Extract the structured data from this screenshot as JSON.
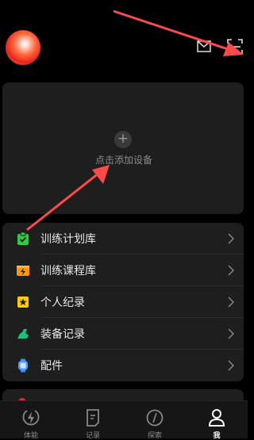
{
  "header": {
    "avatar": "user-avatar",
    "icons": [
      "mail-icon",
      "scan-icon"
    ]
  },
  "device": {
    "add_symbol": "+",
    "add_label": "点击添加设备"
  },
  "menu": {
    "items": [
      {
        "label": "训练计划库",
        "icon": "clipboard-icon",
        "color": "#2ecc40"
      },
      {
        "label": "训练课程库",
        "icon": "lightning-box-icon",
        "color": "#ff9500"
      },
      {
        "label": "个人纪录",
        "icon": "star-badge-icon",
        "color": "#ffcc00"
      },
      {
        "label": "装备记录",
        "icon": "shoe-icon",
        "color": "#19c37d"
      },
      {
        "label": "配件",
        "icon": "watch-icon",
        "color": "#3a8ef6"
      }
    ]
  },
  "tabbar": {
    "tabs": [
      {
        "label": "体能",
        "active": false
      },
      {
        "label": "记录",
        "active": false
      },
      {
        "label": "探索",
        "active": false
      },
      {
        "label": "我",
        "active": true
      }
    ]
  },
  "colors": {
    "background": "#000000",
    "card": "#1e1e1e",
    "arrow": "#ff4a4a"
  }
}
